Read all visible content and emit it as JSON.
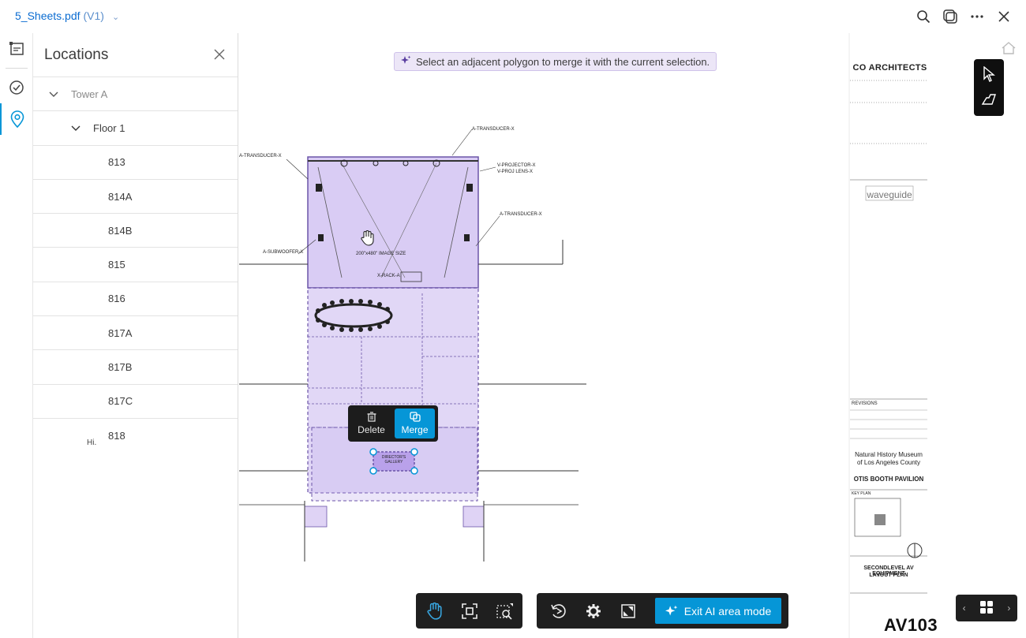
{
  "header": {
    "file_name": "5_Sheets.pdf",
    "version": "(V1)",
    "icons": [
      "search-icon",
      "compare-icon",
      "more-icon",
      "close-icon"
    ]
  },
  "rail": {
    "icons": [
      "sheets-icon",
      "checklist-icon",
      "location-pin-icon"
    ]
  },
  "panel": {
    "title": "Locations",
    "tower": "Tower A",
    "floor": "Floor 1",
    "locations": [
      "813",
      "814A",
      "814B",
      "815",
      "816",
      "817A",
      "817B",
      "817C",
      "818"
    ],
    "hint": "Hi."
  },
  "canvas": {
    "banner": "Select an adjacent polygon to merge it with the current selection.",
    "context_menu": {
      "delete_label": "Delete",
      "merge_label": "Merge"
    },
    "title_block": {
      "firm": "CO ARCHITECTS",
      "consultant": "waveguide",
      "revisions": "REVISIONS",
      "project_line1": "Natural History Museum",
      "project_line2": "of Los Angeles County",
      "project_line3": "OTIS BOOTH PAVILION",
      "key_plan": "KEY PLAN",
      "sheet_title_line1": "SECONDLEVEL AV EQUIPMENT",
      "sheet_title_line2": "LAYOUT PLAN",
      "sheet_number": "AV103"
    },
    "drawing_labels": {
      "transducer_top": "A-TRANSDUCER-X",
      "projector": "V-PROJECTOR-X",
      "proj_lens": "V-PROJ LENS-X",
      "subwoofer": "A-SUBWOOFER-X",
      "transducer_right": "A-TRANSDUCER-X",
      "transducer_left": "A-TRANSDUCER-X",
      "image_size": "200\"x480\" IMAGE SIZE",
      "rack": "X-RACK-A",
      "gallery": "DIRECTOR'S GALLERY"
    }
  },
  "bottom_toolbar": {
    "exit_label": "Exit AI area mode",
    "tools": [
      "pan-hand-icon",
      "fit-view-icon",
      "zoom-window-icon",
      "rotate-icon",
      "settings-icon",
      "fullscreen-icon"
    ]
  },
  "colors": {
    "accent": "#0696d7",
    "selection_fill": "#c9b6ef",
    "title_link": "#0b6cd1"
  }
}
